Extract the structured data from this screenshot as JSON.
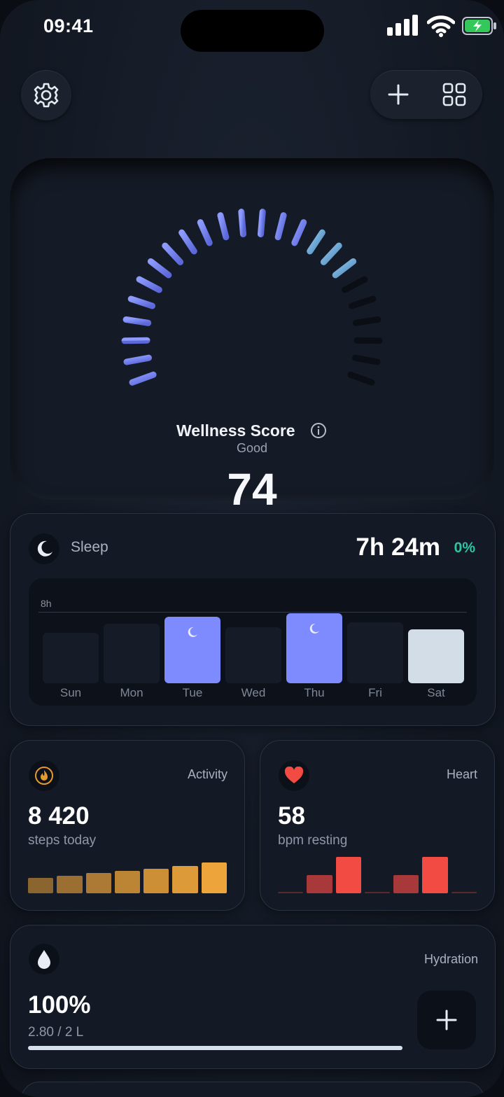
{
  "status_bar": {
    "time": "09:41"
  },
  "wellness": {
    "status": "Good",
    "score": "74",
    "score_fraction": 0.74,
    "title": "Wellness Score"
  },
  "sleep": {
    "label": "Sleep",
    "value": "7h 24m",
    "change": "0%",
    "ref_label": "8h",
    "days": [
      {
        "day": "Sun",
        "hours": 5.8,
        "highlight": "none"
      },
      {
        "day": "Mon",
        "hours": 6.8,
        "highlight": "none"
      },
      {
        "day": "Tue",
        "hours": 7.6,
        "highlight": "accent"
      },
      {
        "day": "Wed",
        "hours": 6.4,
        "highlight": "none"
      },
      {
        "day": "Thu",
        "hours": 8.0,
        "highlight": "accent"
      },
      {
        "day": "Fri",
        "hours": 7.0,
        "highlight": "none"
      },
      {
        "day": "Sat",
        "hours": 6.2,
        "highlight": "light"
      }
    ]
  },
  "activity": {
    "label": "Activity",
    "value": "8 420",
    "sub": "steps today",
    "bars": [
      0.42,
      0.48,
      0.55,
      0.62,
      0.68,
      0.75,
      0.85
    ]
  },
  "heart": {
    "label": "Heart",
    "value": "58",
    "sub": "bpm resting",
    "bars": [
      0.0,
      0.5,
      1.0,
      0.0,
      0.5,
      1.0,
      0.0
    ]
  },
  "hydration": {
    "label": "Hydration",
    "percent": "100%",
    "amount": "2.80 / 2 L",
    "fill_fraction": 1.0
  },
  "colors": {
    "accent": "#7d8bff",
    "teal": "#31c4a3",
    "activity_orange": "#eda43a",
    "heart_red": "#f24b43"
  },
  "icons": {
    "settings": "gear-icon",
    "add": "plus-icon",
    "widgets": "grid-icon",
    "info": "info-icon",
    "sleep": "moon-icon",
    "activity": "flame-icon",
    "heart": "heart-icon",
    "hydration": "droplet-icon"
  }
}
